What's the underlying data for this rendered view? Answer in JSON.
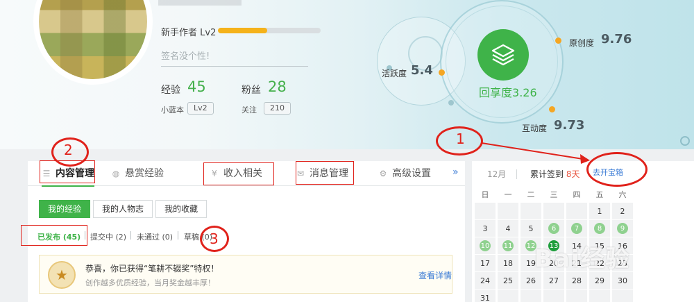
{
  "profile": {
    "level_label": "新手作者 Lv2",
    "level_progress": 0.48,
    "signature_placeholder": "签名没个性!",
    "exp_label": "经验",
    "exp_value": "45",
    "fans_label": "粉丝",
    "fans_value": "28",
    "badge_label": "小蓝本",
    "badge_level": "Lv2",
    "follow_label": "关注",
    "follow_value": "210"
  },
  "metrics": {
    "activity_label": "活跃度",
    "activity_value": "5.4",
    "original_label": "原创度",
    "original_value": "9.76",
    "share_label": "回享度",
    "share_value": "3.26",
    "interaction_label": "互动度",
    "interaction_value": "9.73",
    "colors": {
      "accent_green": "#3fb349",
      "orange_dot": "#f5a623"
    }
  },
  "tabs": [
    {
      "label": "内容管理",
      "icon": "list-icon"
    },
    {
      "label": "悬赏经验",
      "icon": "coin-icon"
    },
    {
      "label": "收入相关",
      "icon": "yen-icon"
    },
    {
      "label": "消息管理",
      "icon": "mail-icon"
    },
    {
      "label": "高级设置",
      "icon": "gear-icon"
    }
  ],
  "tabs_more": "»",
  "subtabs": [
    "我的经验",
    "我的人物志",
    "我的收藏"
  ],
  "filters": [
    "已发布 (45)",
    "提交中 (2)",
    "未通过 (0)",
    "草稿 (0)"
  ],
  "notice": {
    "title": "恭喜，你已获得“笔耕不辍奖”特权！",
    "subtitle": "创作越多优质经验，当月奖金越丰厚！",
    "link": "查看详情"
  },
  "calendar": {
    "month": "12月",
    "streak_prefix": "累计签到",
    "streak_value": "8天",
    "treasure_button": "去开宝箱",
    "weekdays": [
      "日",
      "一",
      "二",
      "三",
      "四",
      "五",
      "六"
    ],
    "rows": [
      [
        "",
        "",
        "",
        "",
        "",
        "1",
        "2"
      ],
      [
        "3",
        "4",
        "5",
        "6",
        "7",
        "8",
        "9"
      ],
      [
        "10",
        "11",
        "12",
        "13",
        "14",
        "15",
        "16"
      ],
      [
        "17",
        "18",
        "19",
        "20",
        "21",
        "22",
        "23"
      ],
      [
        "24",
        "25",
        "26",
        "27",
        "28",
        "29",
        "30"
      ],
      [
        "31",
        "",
        "",
        "",
        "",
        "",
        ""
      ]
    ],
    "signed_days": [
      "6",
      "7",
      "8",
      "9",
      "10",
      "11",
      "12",
      "13"
    ],
    "today": "13"
  },
  "annotations": {
    "one": "1",
    "two": "2",
    "three": "3"
  },
  "watermark": "Bai经验"
}
